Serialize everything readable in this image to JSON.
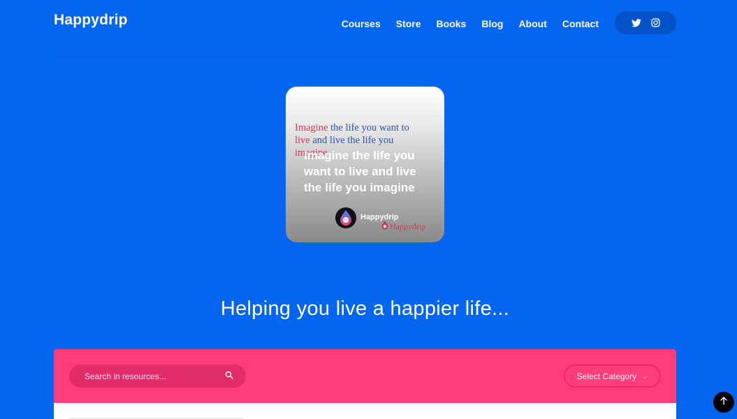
{
  "brand": {
    "name": "Happydrip"
  },
  "nav": {
    "items": [
      {
        "label": "Courses"
      },
      {
        "label": "Store"
      },
      {
        "label": "Books"
      },
      {
        "label": "Blog"
      },
      {
        "label": "About"
      },
      {
        "label": "Contact"
      }
    ]
  },
  "social": {
    "icons": [
      "twitter-icon",
      "instagram-icon"
    ]
  },
  "hero_card": {
    "serif_part1": "Imagine ",
    "serif_part2": "the life ",
    "serif_part3": "you want to",
    "serif_line2a": "live ",
    "serif_line2b": "and live the life you",
    "serif_line3": "imagine",
    "main_text": "Imagine the life you want to live and live the life you imagine",
    "brand_label": "Happydrip",
    "brand_label_serif": "Happydrip"
  },
  "tagline": "Helping you live a happier life...",
  "filter": {
    "search_placeholder": "Search in resources...",
    "category_label": "Select Category"
  },
  "colors": {
    "background": "#0466F0",
    "filter_bar": "#FF3B7A",
    "search_bg": "#E12C68",
    "social_pill": "#0352C7"
  }
}
